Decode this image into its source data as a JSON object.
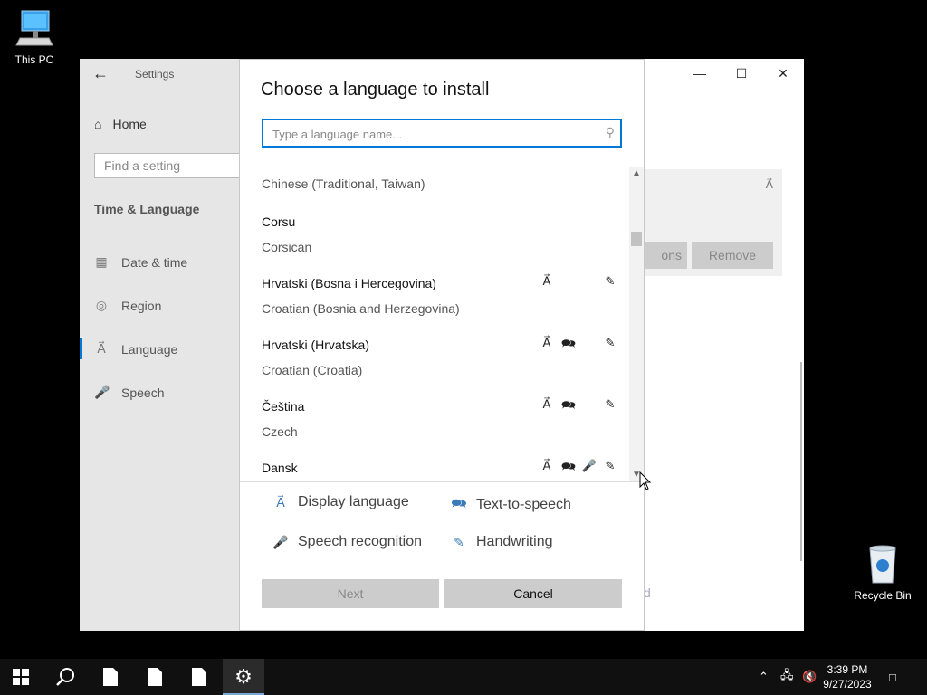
{
  "desktop": {
    "this_pc": "This PC",
    "recycle_bin": "Recycle Bin"
  },
  "settings": {
    "title": "Settings",
    "home": "Home",
    "find_placeholder": "Find a setting",
    "section": "Time & Language",
    "nav": [
      {
        "label": "Date & time",
        "icon": "calendar-icon"
      },
      {
        "label": "Region",
        "icon": "globe-icon"
      },
      {
        "label": "Language",
        "icon": "language-icon"
      },
      {
        "label": "Speech",
        "icon": "microphone-icon"
      }
    ],
    "bg_options_label": "ons",
    "bg_remove_label": "Remove",
    "bg_fragment": "d"
  },
  "dialog": {
    "title": "Choose a language to install",
    "search_placeholder": "Type a language name...",
    "languages": [
      {
        "native": "",
        "english": "Chinese (Traditional, Taiwan)"
      },
      {
        "native": "Corsu",
        "english": "Corsican",
        "features": []
      },
      {
        "native": "Hrvatski (Bosna i Hercegovina)",
        "english": "Croatian (Bosnia and Herzegovina)",
        "features": [
          "display",
          "handwriting"
        ]
      },
      {
        "native": "Hrvatski (Hrvatska)",
        "english": "Croatian (Croatia)",
        "features": [
          "display",
          "tts",
          "handwriting"
        ]
      },
      {
        "native": "Čeština",
        "english": "Czech",
        "features": [
          "display",
          "tts",
          "handwriting"
        ]
      },
      {
        "native": "Dansk",
        "english": "",
        "features": [
          "display",
          "tts",
          "speech",
          "handwriting"
        ]
      }
    ],
    "legend": {
      "display": "Display language",
      "tts": "Text-to-speech",
      "speech": "Speech recognition",
      "handwriting": "Handwriting"
    },
    "next": "Next",
    "cancel": "Cancel"
  },
  "taskbar": {
    "time": "3:39 PM",
    "date": "9/27/2023"
  }
}
